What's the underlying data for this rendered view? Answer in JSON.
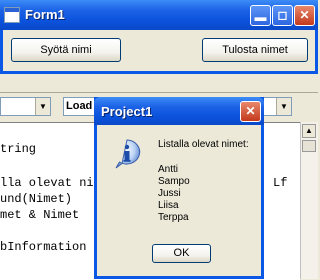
{
  "form1": {
    "title": "Form1",
    "buttons": {
      "enter_names": "Syötä nimi",
      "print_names": "Tulosta nimet"
    }
  },
  "ide": {
    "proc_combo": "",
    "event_combo": "Load",
    "code_lines": [
      "tring",
      "",
      "lla olevat ni",
      "und(Nimet)",
      "met & Nimet",
      "",
      "bInformation"
    ],
    "code_overflow_right": "Lf"
  },
  "msgbox": {
    "title": "Project1",
    "message_heading": "Listalla olevat nimet:",
    "names": [
      "Antti",
      "Sampo",
      "Jussi",
      "Liisa",
      "Terppa"
    ],
    "ok_label": "OK"
  }
}
